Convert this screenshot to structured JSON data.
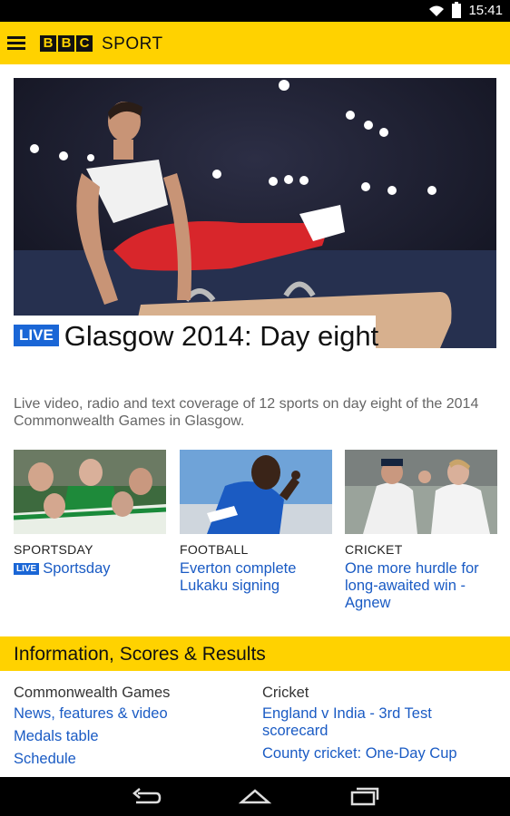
{
  "status": {
    "time": "15:41"
  },
  "app": {
    "logo_letters": [
      "B",
      "B",
      "C"
    ],
    "section": "SPORT"
  },
  "hero": {
    "badge": "LIVE",
    "title": "Glasgow 2014: Day eight",
    "summary": "Live video, radio and text coverage of 12 sports on day eight of the 2014 Commonwealth Games in Glasgow."
  },
  "cards": [
    {
      "section": "SPORTSDAY",
      "badge": "LIVE",
      "title": "Sportsday"
    },
    {
      "section": "FOOTBALL",
      "title": "Everton complete Lukaku signing"
    },
    {
      "section": "CRICKET",
      "title": "One more hurdle for long-awaited win - Agnew"
    }
  ],
  "info": {
    "title": "Information, Scores & Results",
    "columns": [
      {
        "heading": "Commonwealth Games",
        "links": [
          "News, features & video",
          "Medals table",
          "Schedule"
        ]
      },
      {
        "heading": "Cricket",
        "links": [
          "England v India - 3rd Test scorecard",
          "County cricket: One-Day Cup"
        ]
      }
    ]
  },
  "colors": {
    "brand_yellow": "#ffd200",
    "link_blue": "#1a5bc4",
    "live_blue": "#1a66d6"
  }
}
